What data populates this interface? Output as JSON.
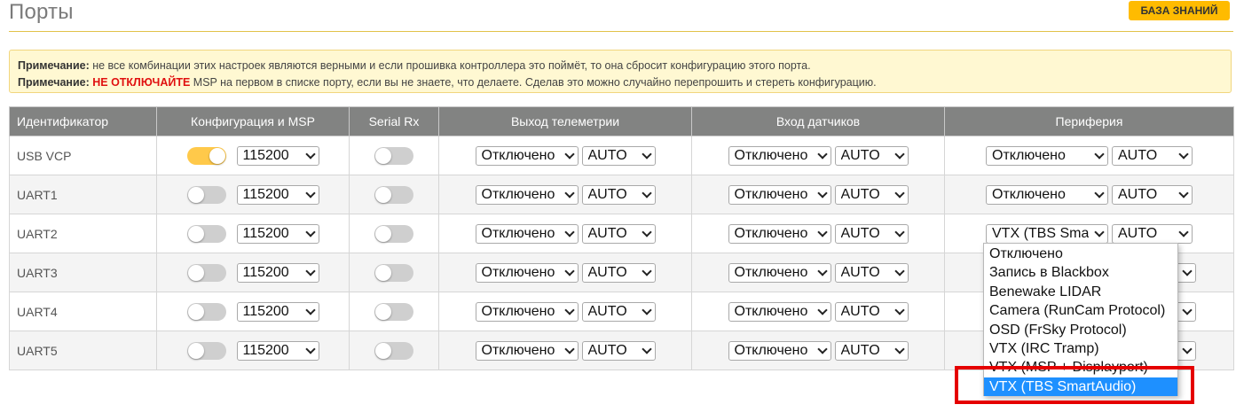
{
  "page": {
    "title": "Порты",
    "kb_button": "БАЗА ЗНАНИЙ"
  },
  "notes": [
    {
      "label": "Примечание:",
      "warning": "",
      "text": " не все комбинации этих настроек являются верными и если прошивка контроллера это поймёт, то она сбросит конфигурацию этого порта."
    },
    {
      "label": "Примечание:",
      "warning": "НЕ ОТКЛЮЧАЙТЕ",
      "text": " MSP на первом в списке порту, если вы не знаете, что делаете. Сделав это можно случайно перепрошить и стереть конфигурацию."
    }
  ],
  "table": {
    "headers": [
      "Идентификатор",
      "Конфигурация и MSP",
      "Serial Rx",
      "Выход телеметрии",
      "Вход датчиков",
      "Периферия"
    ],
    "rows": [
      {
        "id": "USB VCP",
        "msp_on": true,
        "baud": "115200",
        "serial_rx_on": false,
        "telemetry": "Отключено",
        "telemetry_rate": "AUTO",
        "sensor": "Отключено",
        "sensor_rate": "AUTO",
        "peripheral": "Отключено",
        "peripheral_rate": "AUTO"
      },
      {
        "id": "UART1",
        "msp_on": false,
        "baud": "115200",
        "serial_rx_on": false,
        "telemetry": "Отключено",
        "telemetry_rate": "AUTO",
        "sensor": "Отключено",
        "sensor_rate": "AUTO",
        "peripheral": "Отключено",
        "peripheral_rate": "AUTO"
      },
      {
        "id": "UART2",
        "msp_on": false,
        "baud": "115200",
        "serial_rx_on": false,
        "telemetry": "Отключено",
        "telemetry_rate": "AUTO",
        "sensor": "Отключено",
        "sensor_rate": "AUTO",
        "peripheral": "VTX (TBS Sma",
        "peripheral_rate": "AUTO"
      },
      {
        "id": "UART3",
        "msp_on": false,
        "baud": "115200",
        "serial_rx_on": false,
        "telemetry": "Отключено",
        "telemetry_rate": "AUTO",
        "sensor": "Отключено",
        "sensor_rate": "AUTO",
        "peripheral": "",
        "peripheral_rate": ""
      },
      {
        "id": "UART4",
        "msp_on": false,
        "baud": "115200",
        "serial_rx_on": false,
        "telemetry": "Отключено",
        "telemetry_rate": "AUTO",
        "sensor": "Отключено",
        "sensor_rate": "AUTO",
        "peripheral": "",
        "peripheral_rate": ""
      },
      {
        "id": "UART5",
        "msp_on": false,
        "baud": "115200",
        "serial_rx_on": false,
        "telemetry": "Отключено",
        "telemetry_rate": "AUTO",
        "sensor": "Отключено",
        "sensor_rate": "AUTO",
        "peripheral": "",
        "peripheral_rate": ""
      }
    ]
  },
  "peripheral_dropdown": {
    "options": [
      "Отключено",
      "Запись в Blackbox",
      "Benewake LIDAR",
      "Camera (RunCam Protocol)",
      "OSD (FrSky Protocol)",
      "VTX (IRC Tramp)",
      "VTX (MSP + Displayport)",
      "VTX (TBS SmartAudio)"
    ],
    "selected": "VTX (TBS SmartAudio)"
  },
  "colors": {
    "accent": "#ffbb00",
    "header_bg": "#828382",
    "note_bg": "#fff8d2",
    "warning": "#e01010",
    "toggle_on": "#ffc94a",
    "selected_option": "#1e90ff",
    "highlight": "#e50000"
  }
}
